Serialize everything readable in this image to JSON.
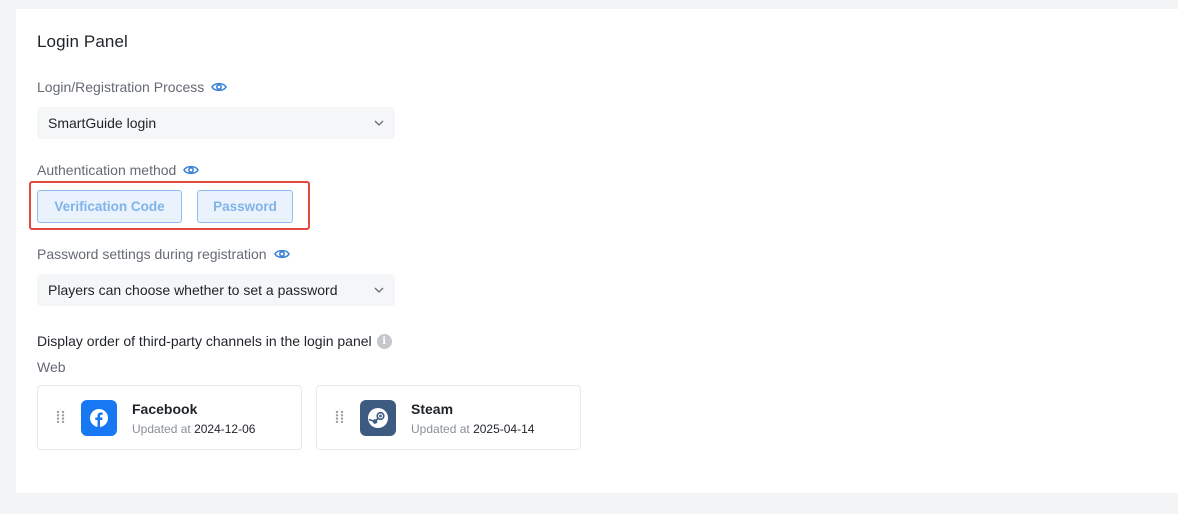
{
  "panel": {
    "title": "Login Panel"
  },
  "login_process": {
    "label": "Login/Registration Process",
    "value": "SmartGuide login"
  },
  "auth_method": {
    "label": "Authentication method",
    "options": [
      "Verification Code",
      "Password"
    ]
  },
  "password_settings": {
    "label": "Password settings during registration",
    "value": "Players can choose whether to set a password"
  },
  "third_party": {
    "label": "Display order of third-party channels in the login panel",
    "info_glyph": "i",
    "platform": "Web",
    "updated_prefix": "Updated at",
    "channels": [
      {
        "name": "Facebook",
        "date": "2024-12-06",
        "icon": "facebook-icon",
        "color": "#1877f2"
      },
      {
        "name": "Steam",
        "date": "2025-04-14",
        "icon": "steam-icon",
        "color": "#3d5a80"
      }
    ]
  },
  "colors": {
    "accent": "#4a90e2",
    "highlight_border": "#e2483d"
  }
}
